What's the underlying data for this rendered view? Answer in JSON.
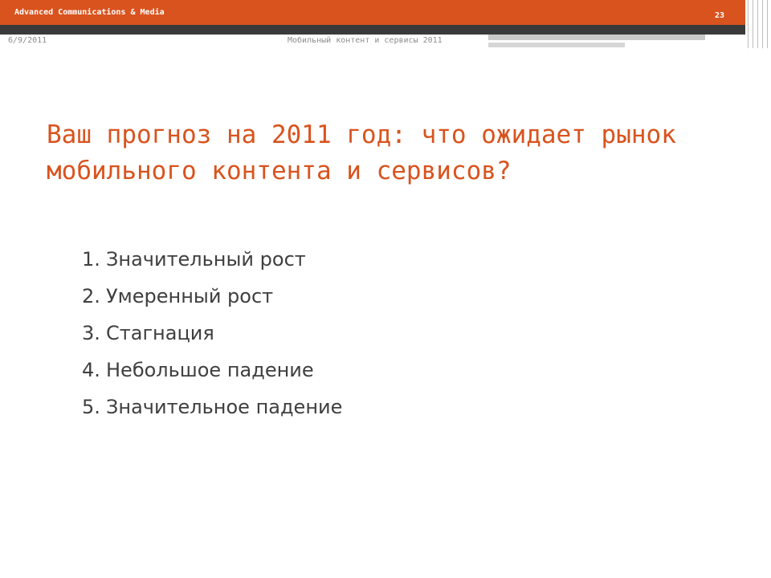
{
  "header": {
    "brand": "Advanced Communications & Media",
    "slide_number": "23"
  },
  "footer": {
    "date": "6/9/2011",
    "title": "Мобильный контент и сервисы 2011"
  },
  "slide": {
    "title": "Ваш прогноз на 2011 год: что ожидает рынок мобильного контента и сервисов?",
    "options": [
      {
        "number": "1.",
        "label": "Значительный рост"
      },
      {
        "number": "2.",
        "label": "Умеренный рост"
      },
      {
        "number": "3.",
        "label": "Стагнация"
      },
      {
        "number": "4.",
        "label": "Небольшое падение"
      },
      {
        "number": "5.",
        "label": "Значительное падение"
      }
    ]
  },
  "colors": {
    "accent": "#d9531e",
    "dark_band": "#3a3a3a",
    "body_text": "#3f3f3f",
    "footer_text": "#8c8c8c"
  }
}
